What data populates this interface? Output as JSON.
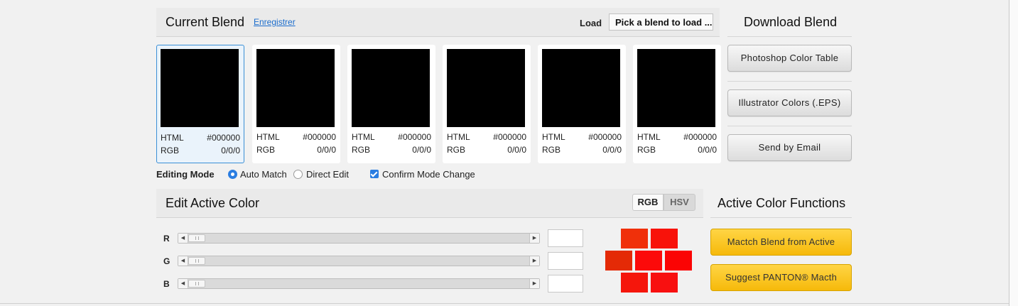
{
  "blend": {
    "title": "Current Blend",
    "save_link": "Enregistrer",
    "load_label": "Load",
    "load_select_value": "Pick a blend to load ..."
  },
  "swatches": [
    {
      "html_label": "HTML",
      "html_value": "#000000",
      "rgb_label": "RGB",
      "rgb_value": "0/0/0",
      "color": "#000000",
      "active": true
    },
    {
      "html_label": "HTML",
      "html_value": "#000000",
      "rgb_label": "RGB",
      "rgb_value": "0/0/0",
      "color": "#000000",
      "active": false
    },
    {
      "html_label": "HTML",
      "html_value": "#000000",
      "rgb_label": "RGB",
      "rgb_value": "0/0/0",
      "color": "#000000",
      "active": false
    },
    {
      "html_label": "HTML",
      "html_value": "#000000",
      "rgb_label": "RGB",
      "rgb_value": "0/0/0",
      "color": "#000000",
      "active": false
    },
    {
      "html_label": "HTML",
      "html_value": "#000000",
      "rgb_label": "RGB",
      "rgb_value": "0/0/0",
      "color": "#000000",
      "active": false
    },
    {
      "html_label": "HTML",
      "html_value": "#000000",
      "rgb_label": "RGB",
      "rgb_value": "0/0/0",
      "color": "#000000",
      "active": false
    }
  ],
  "download": {
    "title": "Download Blend",
    "buttons": [
      "Photoshop Color Table",
      "Illustrator Colors (.EPS)",
      "Send by Email"
    ]
  },
  "editing_mode": {
    "label": "Editing Mode",
    "options": [
      {
        "label": "Auto Match",
        "selected": true
      },
      {
        "label": "Direct Edit",
        "selected": false
      }
    ],
    "confirm_label": "Confirm Mode Change",
    "confirm_checked": true
  },
  "edit_color": {
    "title": "Edit Active Color",
    "modes": {
      "rgb": "RGB",
      "hsv": "HSV",
      "active": "RGB"
    },
    "channels": [
      {
        "label": "R",
        "value": ""
      },
      {
        "label": "G",
        "value": ""
      },
      {
        "label": "B",
        "value": ""
      }
    ]
  },
  "functions": {
    "title": "Active Color Functions",
    "buttons": [
      "Mactch Blend from Active",
      "Suggest PANTON® Macth"
    ]
  },
  "colors": {
    "accent_blue": "#2a7de1",
    "button_yellow": "#ffcc2a",
    "brick_colors": [
      "#f0300a",
      "#f8120a",
      "#e42a06",
      "#fc0a0a",
      "#fb0404",
      "#f5160c",
      "#f81010",
      "#f40c0c",
      "#fb0808"
    ]
  }
}
